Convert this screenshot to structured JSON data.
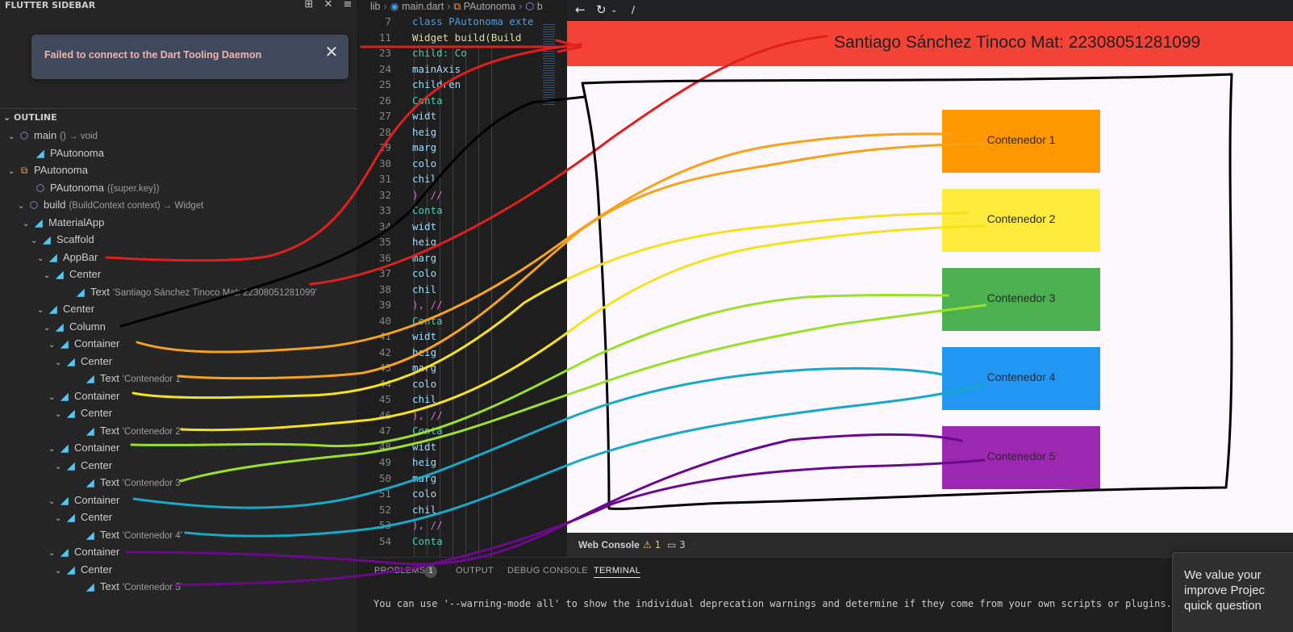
{
  "sidebar": {
    "title": "FLUTTER SIDEBAR",
    "toast": {
      "message": "Failed to connect to the Dart Tooling Daemon"
    },
    "outline": {
      "title": "OUTLINE",
      "items": [
        {
          "label": "main",
          "detail": "() → void",
          "icon": "cube-icon"
        },
        {
          "label": "PAutonoma",
          "detail": "",
          "icon": "flutter-icon"
        },
        {
          "label": "PAutonoma",
          "detail": "",
          "icon": "class-icon"
        },
        {
          "label": "PAutonoma",
          "detail": "({super.key})",
          "icon": "cube-icon"
        },
        {
          "label": "build",
          "detail": "(BuildContext context) → Widget",
          "icon": "cube-icon"
        },
        {
          "label": "MaterialApp",
          "detail": "",
          "icon": "flutter-icon"
        },
        {
          "label": "Scaffold",
          "detail": "",
          "icon": "flutter-icon"
        },
        {
          "label": "AppBar",
          "detail": "",
          "icon": "flutter-icon"
        },
        {
          "label": "Center",
          "detail": "",
          "icon": "flutter-icon"
        },
        {
          "label": "Text",
          "detail": "'Santiago Sánchez Tinoco Mat: 22308051281099'",
          "icon": "flutter-icon"
        },
        {
          "label": "Center",
          "detail": "",
          "icon": "flutter-icon"
        },
        {
          "label": "Column",
          "detail": "",
          "icon": "flutter-icon"
        },
        {
          "label": "Container",
          "detail": "",
          "icon": "flutter-icon"
        },
        {
          "label": "Center",
          "detail": "",
          "icon": "flutter-icon"
        },
        {
          "label": "Text",
          "detail": "'Contenedor 1'",
          "icon": "flutter-icon"
        },
        {
          "label": "Container",
          "detail": "",
          "icon": "flutter-icon"
        },
        {
          "label": "Center",
          "detail": "",
          "icon": "flutter-icon"
        },
        {
          "label": "Text",
          "detail": "'Contenedor 2'",
          "icon": "flutter-icon"
        },
        {
          "label": "Container",
          "detail": "",
          "icon": "flutter-icon"
        },
        {
          "label": "Center",
          "detail": "",
          "icon": "flutter-icon"
        },
        {
          "label": "Text",
          "detail": "'Contenedor 3'",
          "icon": "flutter-icon"
        },
        {
          "label": "Container",
          "detail": "",
          "icon": "flutter-icon"
        },
        {
          "label": "Center",
          "detail": "",
          "icon": "flutter-icon"
        },
        {
          "label": "Text",
          "detail": "'Contenedor 4'",
          "icon": "flutter-icon"
        },
        {
          "label": "Container",
          "detail": "",
          "icon": "flutter-icon"
        },
        {
          "label": "Center",
          "detail": "",
          "icon": "flutter-icon"
        },
        {
          "label": "Text",
          "detail": "'Contenedor 5'",
          "icon": "flutter-icon"
        }
      ]
    }
  },
  "editor": {
    "breadcrumb": [
      "lib",
      "main.dart",
      "PAutonoma",
      "b"
    ],
    "lines": [
      {
        "num": "7",
        "code": "class PAutonoma exte"
      },
      {
        "num": "11",
        "code": "  Widget build(Build"
      },
      {
        "num": "23",
        "code": "        child: Co"
      },
      {
        "num": "24",
        "code": "          mainAxis"
      },
      {
        "num": "25",
        "code": "          children"
      },
      {
        "num": "26",
        "code": "            Conta"
      },
      {
        "num": "27",
        "code": "              widt"
      },
      {
        "num": "28",
        "code": "              heig"
      },
      {
        "num": "29",
        "code": "              marg"
      },
      {
        "num": "30",
        "code": "              colo"
      },
      {
        "num": "31",
        "code": "              chil"
      },
      {
        "num": "32",
        "code": "            ), //"
      },
      {
        "num": "33",
        "code": "            Conta"
      },
      {
        "num": "34",
        "code": "              widt"
      },
      {
        "num": "35",
        "code": "              heig"
      },
      {
        "num": "36",
        "code": "              marg"
      },
      {
        "num": "37",
        "code": "              colo"
      },
      {
        "num": "38",
        "code": "              chil"
      },
      {
        "num": "39",
        "code": "            ), //"
      },
      {
        "num": "40",
        "code": "            Conta"
      },
      {
        "num": "41",
        "code": "              widt"
      },
      {
        "num": "42",
        "code": "              heig"
      },
      {
        "num": "43",
        "code": "              marg"
      },
      {
        "num": "44",
        "code": "              colo"
      },
      {
        "num": "45",
        "code": "              chil"
      },
      {
        "num": "46",
        "code": "            ), //"
      },
      {
        "num": "47",
        "code": "            Conta"
      },
      {
        "num": "48",
        "code": "              widt"
      },
      {
        "num": "49",
        "code": "              heig"
      },
      {
        "num": "50",
        "code": "              marg"
      },
      {
        "num": "51",
        "code": "              colo"
      },
      {
        "num": "52",
        "code": "              chil"
      },
      {
        "num": "53",
        "code": "            ), //"
      },
      {
        "num": "54",
        "code": "            Conta"
      }
    ]
  },
  "preview": {
    "path": "/",
    "appbar_title": "Santiago Sánchez Tinoco Mat: 22308051281099",
    "appbar_color": "#f44336",
    "containers": [
      {
        "label": "Contenedor 1",
        "color": "#ff9800"
      },
      {
        "label": "Contenedor 2",
        "color": "#ffeb3b"
      },
      {
        "label": "Contenedor 3",
        "color": "#4caf50"
      },
      {
        "label": "Contenedor 4",
        "color": "#2196f3"
      },
      {
        "label": "Contenedor 5",
        "color": "#9c27b0"
      }
    ]
  },
  "web_console": {
    "title": "Web Console",
    "warnings": "1",
    "messages": "3"
  },
  "panel": {
    "tabs": [
      "PROBLEMS",
      "OUTPUT",
      "DEBUG CONSOLE",
      "TERMINAL"
    ],
    "problems_count": "1",
    "active_tab": "TERMINAL",
    "terminal_text": "You can use '--warning-mode all' to show the individual deprecation warnings and determine if they come from your own scripts or plugins."
  },
  "notification": {
    "text": "We value your\nimprove Projec\nquick question"
  },
  "annotations": {
    "colors": [
      "#e01f1f",
      "#000000",
      "#f7a21b",
      "#f5e11c",
      "#9be02a",
      "#17a9c7",
      "#6a0a8a"
    ]
  }
}
